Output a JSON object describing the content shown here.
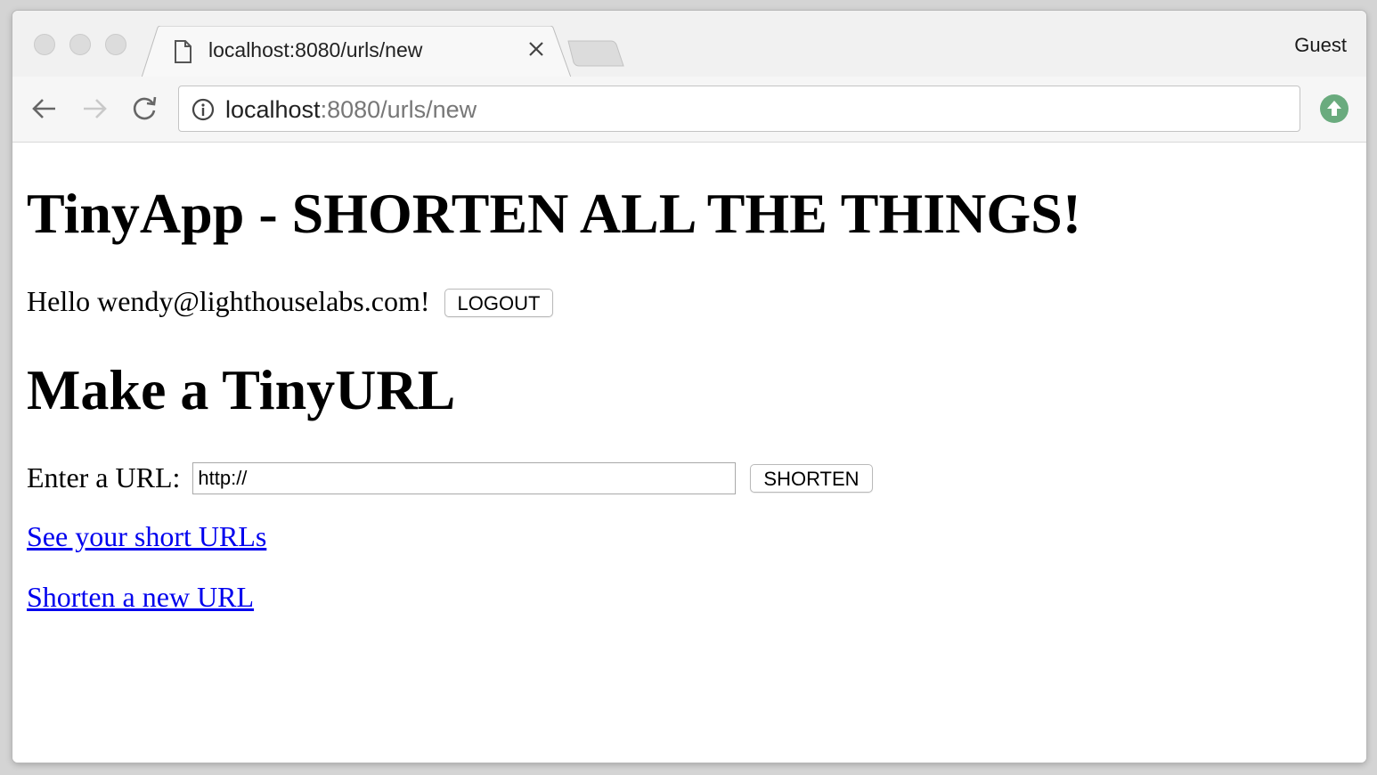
{
  "browser": {
    "tab_title": "localhost:8080/urls/new",
    "profile_label": "Guest",
    "address": {
      "host": "localhost",
      "rest": ":8080/urls/new"
    }
  },
  "page": {
    "heading": "TinyApp - SHORTEN ALL THE THINGS!",
    "greeting": "Hello wendy@lighthouselabs.com!",
    "logout_label": "LOGOUT",
    "subheading": "Make a TinyURL",
    "url_label": "Enter a URL:",
    "url_input_value": "http://",
    "shorten_label": "SHORTEN",
    "links": [
      {
        "label": "See your short URLs"
      },
      {
        "label": "Shorten a new URL"
      }
    ]
  },
  "colors": {
    "link": "#0000ee",
    "update_badge": "#6aab7e"
  },
  "icons": {
    "tab": "page-icon",
    "close": "close-icon",
    "back": "arrow-left-icon",
    "forward": "arrow-right-icon",
    "reload": "reload-icon",
    "info": "info-icon",
    "update": "update-arrow-icon"
  }
}
